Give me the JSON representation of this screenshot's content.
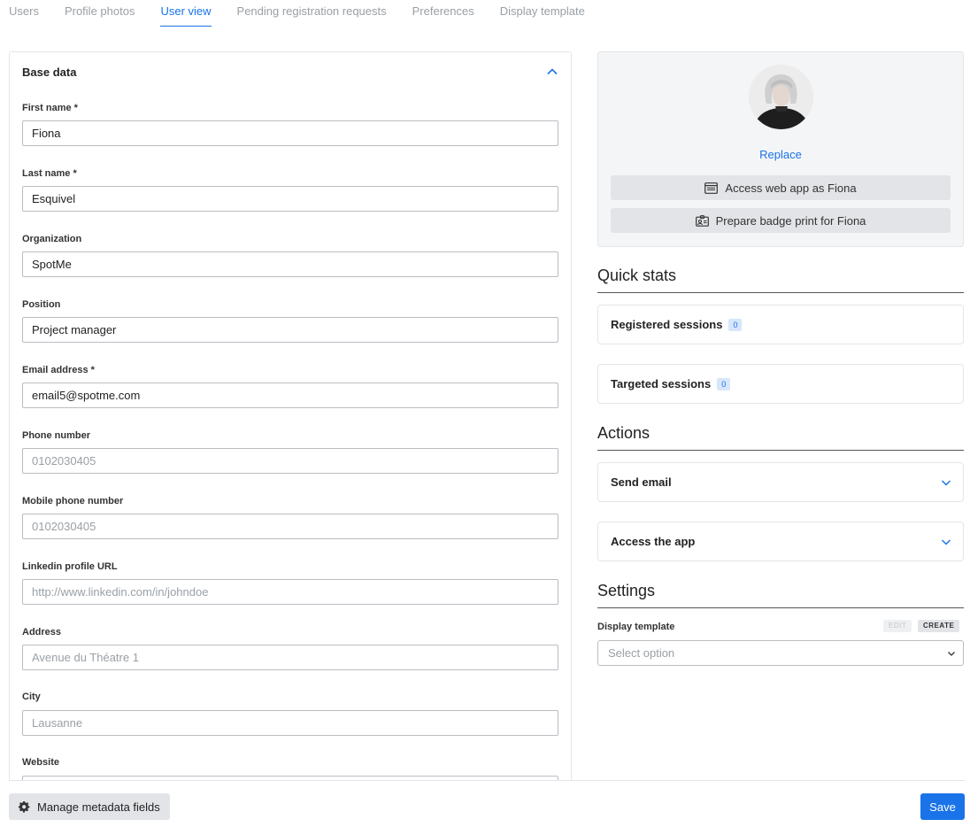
{
  "tabs": [
    {
      "label": "Users"
    },
    {
      "label": "Profile photos"
    },
    {
      "label": "User view"
    },
    {
      "label": "Pending registration requests"
    },
    {
      "label": "Preferences"
    },
    {
      "label": "Display template"
    }
  ],
  "active_tab": "User view",
  "base_data": {
    "title": "Base data",
    "fields": {
      "first_name": {
        "label": "First name *",
        "value": "Fiona",
        "placeholder": ""
      },
      "last_name": {
        "label": "Last name *",
        "value": "Esquivel",
        "placeholder": ""
      },
      "organization": {
        "label": "Organization",
        "value": "SpotMe",
        "placeholder": ""
      },
      "position": {
        "label": "Position",
        "value": "Project manager",
        "placeholder": ""
      },
      "email": {
        "label": "Email address *",
        "value": "email5@spotme.com",
        "placeholder": ""
      },
      "phone": {
        "label": "Phone number",
        "value": "",
        "placeholder": "0102030405"
      },
      "mobile": {
        "label": "Mobile phone number",
        "value": "",
        "placeholder": "0102030405"
      },
      "linkedin": {
        "label": "Linkedin profile URL",
        "value": "",
        "placeholder": "http://www.linkedin.com/in/johndoe"
      },
      "address": {
        "label": "Address",
        "value": "",
        "placeholder": "Avenue du Théatre 1"
      },
      "city": {
        "label": "City",
        "value": "",
        "placeholder": "Lausanne"
      },
      "website": {
        "label": "Website",
        "value": "",
        "placeholder": ""
      }
    }
  },
  "profile": {
    "replace_label": "Replace",
    "access_web_app_label": "Access web app as Fiona",
    "badge_print_label": "Prepare badge print for Fiona"
  },
  "quick_stats": {
    "title": "Quick stats",
    "registered_label": "Registered sessions",
    "registered_count": "0",
    "targeted_label": "Targeted sessions",
    "targeted_count": "0"
  },
  "actions": {
    "title": "Actions",
    "send_email_label": "Send email",
    "access_app_label": "Access the app"
  },
  "settings": {
    "title": "Settings",
    "display_template_label": "Display template",
    "edit_label": "EDIT",
    "create_label": "CREATE",
    "select_placeholder": "Select option"
  },
  "footer": {
    "manage_label": "Manage metadata fields",
    "save_label": "Save"
  },
  "colors": {
    "accent": "#1a73e8",
    "badge_bg": "#d6e6fb",
    "button_gray": "#e2e4e7"
  }
}
